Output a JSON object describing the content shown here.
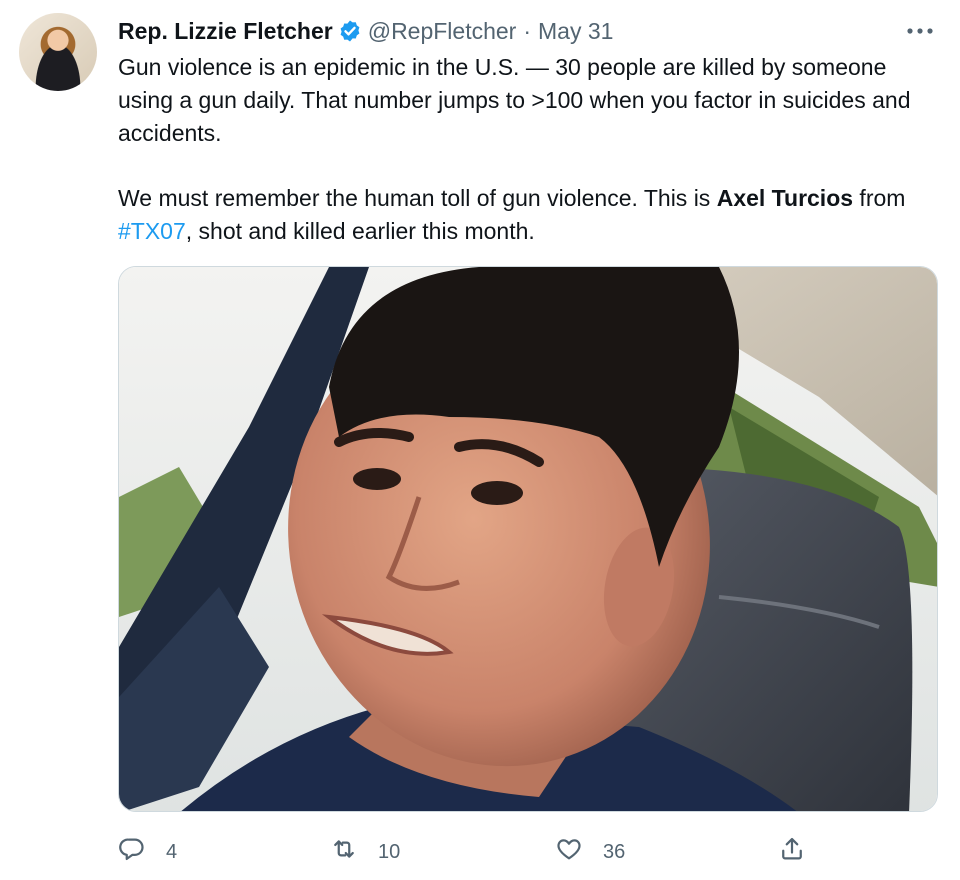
{
  "author": {
    "name": "Rep. Lizzie Fletcher",
    "handle": "@RepFletcher",
    "separator": "·",
    "date": "May 31"
  },
  "tweet": {
    "paragraph1": "Gun violence is an epidemic in the U.S. — 30 people are killed by someone using a gun daily. That number jumps to >100 when you factor in suicides and accidents.",
    "p2_before": "We must remember the human toll of gun violence. This is ",
    "p2_bold": "Axel Turcios",
    "p2_mid": " from ",
    "p2_hashtag": "#TX07",
    "p2_after": ", shot and killed earlier this month."
  },
  "actions": {
    "replies": "4",
    "retweets": "10",
    "likes": "36"
  },
  "icons": {
    "verified": "verified-badge-icon",
    "more": "more-options-icon",
    "reply": "reply-icon",
    "retweet": "retweet-icon",
    "like": "heart-icon",
    "share": "share-icon"
  },
  "colors": {
    "text": "#0f1419",
    "secondary": "#536471",
    "link": "#1d9bf0",
    "verified": "#1d9bf0",
    "border": "#cfd9de"
  }
}
